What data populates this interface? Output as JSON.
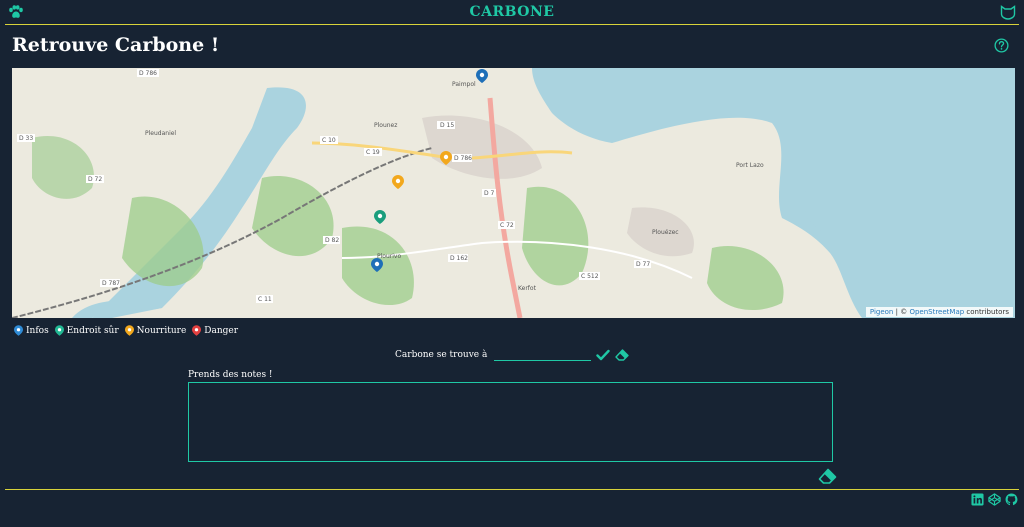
{
  "header": {
    "brand": "CARBONE",
    "menu_icon": "paw-icon",
    "profile_icon": "cat-shield-icon"
  },
  "page": {
    "title": "Retrouve Carbone !",
    "help_icon": "help-icon"
  },
  "map": {
    "labels": [
      {
        "key": "d786a",
        "text": "D 786"
      },
      {
        "key": "paimpol",
        "text": "Paimpol"
      },
      {
        "key": "plourivo",
        "text": "Plourivo"
      },
      {
        "key": "pleudaniel",
        "text": "Pleudaniel"
      },
      {
        "key": "plounez",
        "text": "Plounez"
      },
      {
        "key": "d15",
        "text": "D 15"
      },
      {
        "key": "d786b",
        "text": "D 786"
      },
      {
        "key": "c10",
        "text": "C 10"
      },
      {
        "key": "c19",
        "text": "C 19"
      },
      {
        "key": "d33",
        "text": "D 33"
      },
      {
        "key": "d72",
        "text": "D 72"
      },
      {
        "key": "d7",
        "text": "D 7"
      },
      {
        "key": "c72",
        "text": "C 72"
      },
      {
        "key": "d82",
        "text": "D 82"
      },
      {
        "key": "d162",
        "text": "D 162"
      },
      {
        "key": "kerfot",
        "text": "Kerfot"
      },
      {
        "key": "c512",
        "text": "C 512"
      },
      {
        "key": "plouezec",
        "text": "Plouézec"
      },
      {
        "key": "d77",
        "text": "D 77"
      },
      {
        "key": "portlazo",
        "text": "Port Lazo"
      },
      {
        "key": "d787",
        "text": "D 787"
      },
      {
        "key": "c11",
        "text": "C 11"
      }
    ],
    "attribution": {
      "lib": "Pigeon",
      "separator": "|",
      "copyright": "©",
      "source": "OpenStreetMap",
      "suffix": "contributors"
    }
  },
  "legend": [
    {
      "label": "Infos",
      "color": "#2f8bd6"
    },
    {
      "label": "Endroit sûr",
      "color": "#22b894"
    },
    {
      "label": "Nourriture",
      "color": "#f2a81d"
    },
    {
      "label": "Danger",
      "color": "#e24040"
    }
  ],
  "location": {
    "label": "Carbone se trouve à",
    "value": "",
    "confirm_icon": "check-icon",
    "clear_icon": "eraser-icon"
  },
  "notes": {
    "label": "Prends des notes !",
    "value": "",
    "clear_icon": "eraser-icon"
  },
  "footer": {
    "icons": [
      "linkedin-icon",
      "codepen-icon",
      "github-icon"
    ]
  },
  "colors": {
    "background": "#172333",
    "accent": "#1fc8a5",
    "line": "#d8d23a"
  }
}
